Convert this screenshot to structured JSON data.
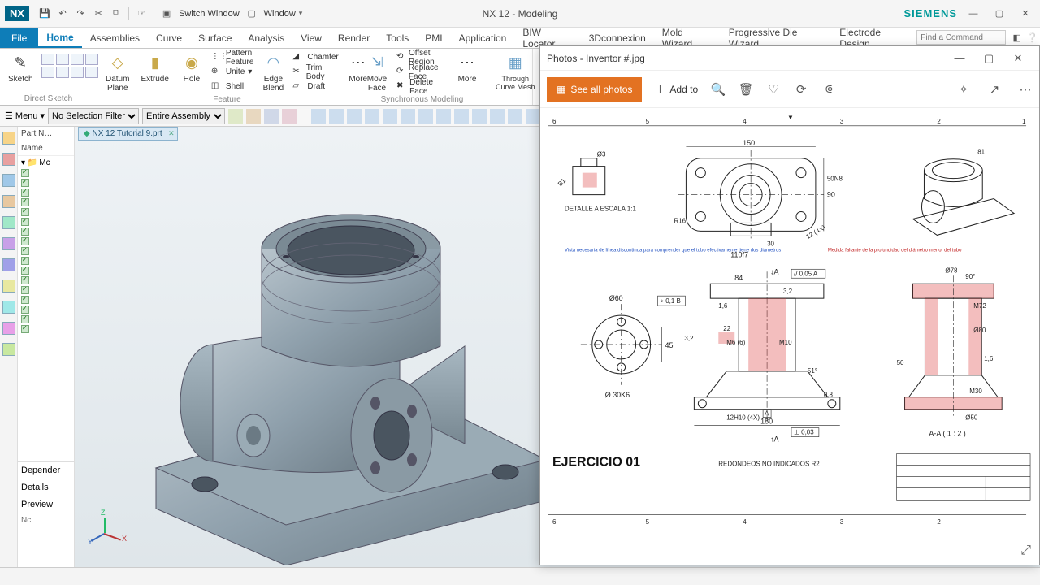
{
  "titlebar": {
    "logo": "NX",
    "switch_window_label": "Switch Window",
    "window_label": "Window",
    "center_title": "NX 12 - Modeling",
    "brand": "SIEMENS"
  },
  "tabs": {
    "file": "File",
    "home": "Home",
    "items": [
      "Assemblies",
      "Curve",
      "Surface",
      "Analysis",
      "View",
      "Render",
      "Tools",
      "PMI",
      "Application",
      "BIW Locator",
      "3Dconnexion",
      "Mold Wizard",
      "Progressive Die Wizard",
      "Electrode Design"
    ],
    "find_placeholder": "Find a Command"
  },
  "ribbon": {
    "sketch": {
      "btn": "Sketch",
      "group": "Direct Sketch"
    },
    "feature": {
      "datum": "Datum\nPlane",
      "extrude": "Extrude",
      "hole": "Hole",
      "pattern": "Pattern Feature",
      "unite": "Unite",
      "shell": "Shell",
      "edgeblend": "Edge\nBlend",
      "chamfer": "Chamfer",
      "trim": "Trim Body",
      "draft": "Draft",
      "more": "More",
      "group": "Feature"
    },
    "sync": {
      "moveface": "Move\nFace",
      "offset": "Offset Region",
      "replace": "Replace Face",
      "delete": "Delete Face",
      "more": "More",
      "group": "Synchronous Modeling"
    },
    "mesh": {
      "btn": "Through\nCurve Mesh"
    }
  },
  "subbar": {
    "menu": "Menu",
    "filter": "No Selection Filter",
    "assembly": "Entire Assembly"
  },
  "nav": {
    "part_nav": "Part N…",
    "name": "Name",
    "root": "Mc",
    "dependencies": "Depender",
    "details": "Details",
    "preview": "Preview",
    "nc": "Nc"
  },
  "doc_tab": "NX 12 Tutorial 9.prt",
  "photos": {
    "title": "Photos - Inventor #.jpg",
    "see_all": "See all photos",
    "add_to": "Add to"
  },
  "drawing": {
    "title": "EJERCICIO 01",
    "note": "REDONDEOS NO INDICADOS R2",
    "section": "A-A ( 1 : 2 )",
    "detail": "DETALLE A\nESCALA 1:1",
    "dims": {
      "d150": "150",
      "d90": "90",
      "d50n8": "50N8",
      "d30": "30",
      "d110f7": "110f7",
      "d84": "84",
      "d180": "180",
      "d12_4x": "12 (4X)",
      "r16": "R16",
      "phi3": "Ø3",
      "b1": "B1",
      "phi60": "Ø60",
      "phi30k6": "Ø 30K6",
      "d45": "45",
      "d3_2a": "3,2",
      "d3_2b": "3,2",
      "t1_6a": "1,6",
      "t1_6b": "1,6",
      "d22": "22",
      "m10": "M10",
      "m6": "M6 (6)",
      "d51": "51°",
      "d0_8": "0,8",
      "h12_4x": "12H10 (4X)",
      "m30": "M30",
      "phi50": "Ø50",
      "phi80": "Ø80",
      "m72": "M72",
      "phi78": "Ø78",
      "d90b": "90°",
      "b81": "81",
      "d50b": "50",
      "tol1": "⌖ 0,1 B",
      "tol2": "// 0,05 A",
      "tol3": "⊥ 0,03",
      "secA1": "A",
      "secA2": "A",
      "blue_note": "Vista necesaria de línea discontinua para comprender que el tubo efectivamente tiene dos diámetros",
      "red_note": "Medida faltante de la profundidad del diámetro menor del tubo",
      "ruler": [
        "6",
        "5",
        "4",
        "3",
        "2",
        "1"
      ]
    }
  }
}
